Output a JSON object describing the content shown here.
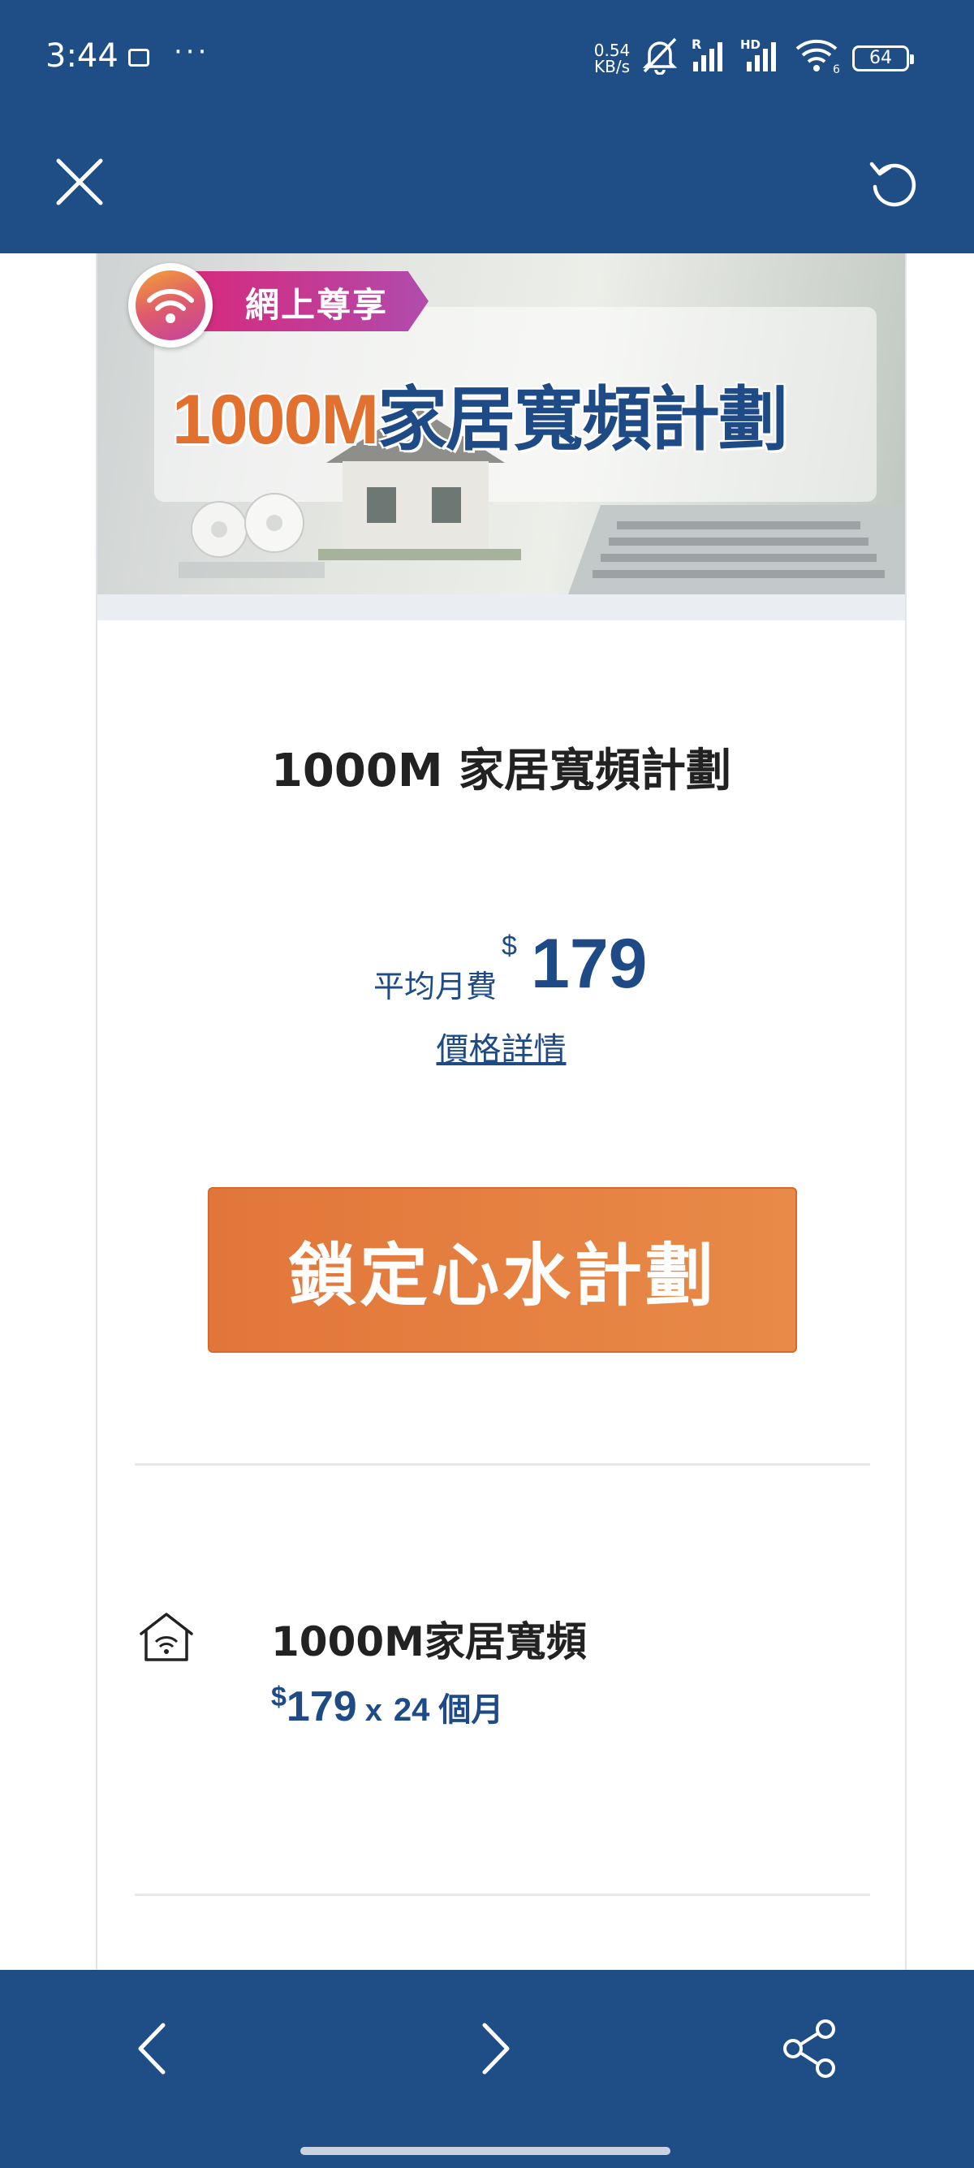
{
  "status_bar": {
    "time": "3:44",
    "net_speed_value": "0.54",
    "net_speed_unit": "KB/s",
    "battery": "64",
    "signal_labels": {
      "r": "R",
      "hd": "HD",
      "wifi_sub": "6"
    }
  },
  "top_bar": {
    "close_icon": "close-icon",
    "refresh_icon": "refresh-icon"
  },
  "banner": {
    "badge": "網上尊享",
    "title_num": "1000M",
    "title_text": "家居寬頻計劃"
  },
  "plan": {
    "title": "1000M 家居寬頻計劃",
    "price_label": "平均月費",
    "currency": "$",
    "price": "179",
    "details_link": "價格詳情",
    "cta_label": "鎖定心水計劃"
  },
  "feature": {
    "icon": "home-wifi-icon",
    "title": "1000M家居寬頻",
    "currency": "$",
    "amount": "179",
    "multiplier": "x",
    "months": "24 個月"
  },
  "bottom_nav": {
    "back_icon": "chevron-left-icon",
    "forward_icon": "chevron-right-icon",
    "share_icon": "share-icon"
  },
  "colors": {
    "brand_blue": "#1f4e87",
    "accent_orange": "#e2763a",
    "price_blue": "#1e4a86"
  }
}
